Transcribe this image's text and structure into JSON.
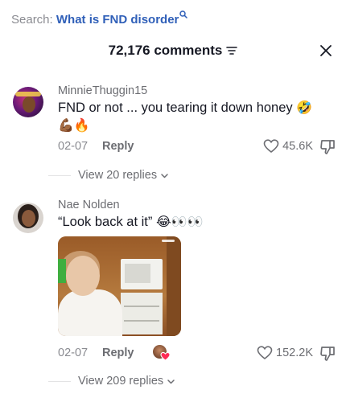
{
  "search": {
    "prefix": "Search:",
    "query": "What is FND disorder"
  },
  "header": {
    "title": "72,176 comments"
  },
  "comments": [
    {
      "username": "MinnieThuggin15",
      "text": "FND or not ... you tearing it down honey",
      "emojis_inline": "🤣",
      "emojis_line2": "💪🏾🔥",
      "date": "02-07",
      "reply_label": "Reply",
      "likes": "45.6K",
      "view_replies": "View 20 replies"
    },
    {
      "username": "Nae Nolden",
      "text": "“Look back at it”",
      "emojis_inline": "😂👀👀",
      "date": "02-07",
      "reply_label": "Reply",
      "likes": "152.2K",
      "view_replies": "View 209 replies"
    }
  ],
  "icons": {
    "search": "search-icon",
    "filter": "filter-icon",
    "close": "close-icon",
    "heart": "heart-outline-icon",
    "dislike": "thumbs-down-icon",
    "chevron": "chevron-down-icon"
  },
  "colors": {
    "search_query": "#2f5fb8",
    "muted_text": "#6c6d72",
    "creator_heart": "#fe2c55"
  }
}
